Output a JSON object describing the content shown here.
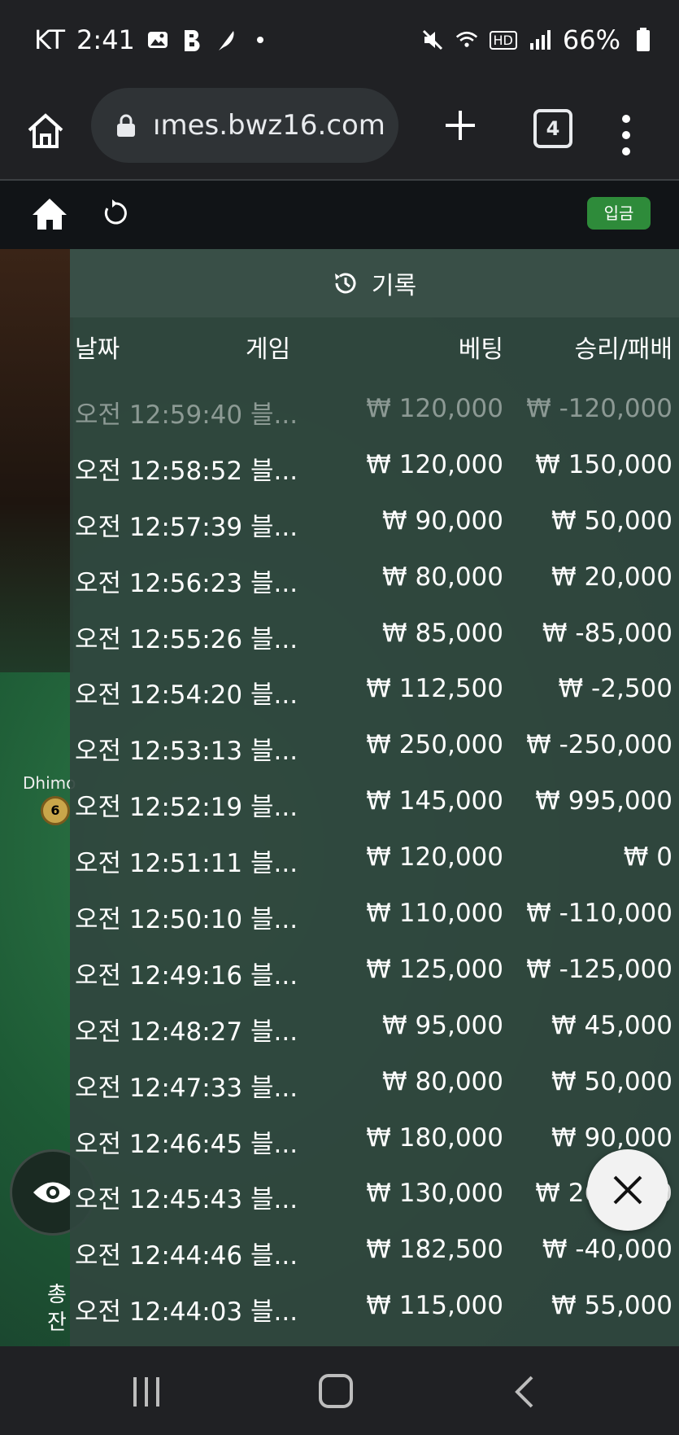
{
  "status_bar": {
    "carrier": "KT",
    "time": "2:41",
    "battery": "66%",
    "hd": "HD"
  },
  "browser": {
    "url": "ımes.bwz16.com",
    "tab_count": "4"
  },
  "game_bar": {
    "deposit_label": "입금"
  },
  "background": {
    "player_name": "Dhimo",
    "chip_level": "6",
    "bottom_text_1": "총",
    "bottom_text_2": "잔"
  },
  "history": {
    "title": "기록",
    "columns": {
      "date": "날짜",
      "game": "게임",
      "bet": "베팅",
      "result": "승리/패배"
    },
    "rows": [
      {
        "date": "오전 12:59:40",
        "game": "블...",
        "bet": "₩ 120,000",
        "result": "₩ -120,000"
      },
      {
        "date": "오전 12:58:52",
        "game": "블...",
        "bet": "₩ 120,000",
        "result": "₩ 150,000"
      },
      {
        "date": "오전 12:57:39",
        "game": "블...",
        "bet": "₩ 90,000",
        "result": "₩ 50,000"
      },
      {
        "date": "오전 12:56:23",
        "game": "블...",
        "bet": "₩ 80,000",
        "result": "₩ 20,000"
      },
      {
        "date": "오전 12:55:26",
        "game": "블...",
        "bet": "₩ 85,000",
        "result": "₩ -85,000"
      },
      {
        "date": "오전 12:54:20",
        "game": "블...",
        "bet": "₩ 112,500",
        "result": "₩ -2,500"
      },
      {
        "date": "오전 12:53:13",
        "game": "블...",
        "bet": "₩ 250,000",
        "result": "₩ -250,000"
      },
      {
        "date": "오전 12:52:19",
        "game": "블...",
        "bet": "₩ 145,000",
        "result": "₩ 995,000"
      },
      {
        "date": "오전 12:51:11",
        "game": "블...",
        "bet": "₩ 120,000",
        "result": "₩ 0"
      },
      {
        "date": "오전 12:50:10",
        "game": "블...",
        "bet": "₩ 110,000",
        "result": "₩ -110,000"
      },
      {
        "date": "오전 12:49:16",
        "game": "블...",
        "bet": "₩ 125,000",
        "result": "₩ -125,000"
      },
      {
        "date": "오전 12:48:27",
        "game": "블...",
        "bet": "₩ 95,000",
        "result": "₩ 45,000"
      },
      {
        "date": "오전 12:47:33",
        "game": "블...",
        "bet": "₩ 80,000",
        "result": "₩ 50,000"
      },
      {
        "date": "오전 12:46:45",
        "game": "블...",
        "bet": "₩ 180,000",
        "result": "₩ 90,000"
      },
      {
        "date": "오전 12:45:43",
        "game": "블...",
        "bet": "₩ 130,000",
        "result": "₩ 260,000"
      },
      {
        "date": "오전 12:44:46",
        "game": "블...",
        "bet": "₩ 182,500",
        "result": "₩ -40,000"
      },
      {
        "date": "오전 12:44:03",
        "game": "블...",
        "bet": "₩ 115,000",
        "result": "₩ 55,000"
      }
    ]
  }
}
